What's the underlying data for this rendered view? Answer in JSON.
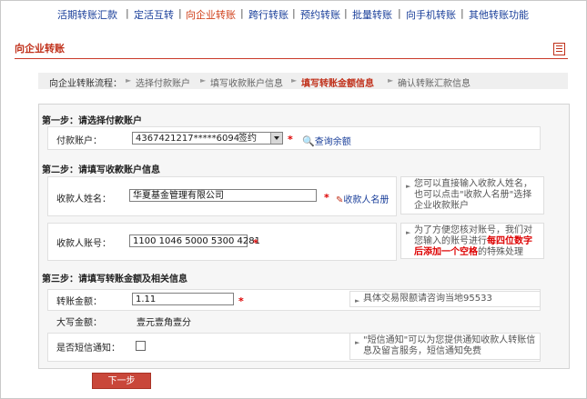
{
  "nav": {
    "items": [
      {
        "label": "活期转账汇款",
        "active": false
      },
      {
        "label": "定活互转",
        "active": false
      },
      {
        "label": "向企业转账",
        "active": true
      },
      {
        "label": "跨行转账",
        "active": false
      },
      {
        "label": "预约转账",
        "active": false
      },
      {
        "label": "批量转账",
        "active": false
      },
      {
        "label": "向手机转账",
        "active": false
      },
      {
        "label": "其他转账功能",
        "active": false
      }
    ],
    "separator": "|"
  },
  "page_title": "向企业转账",
  "breadcrumb": {
    "lead": "向企业转账流程：",
    "steps": [
      "选择付款账户",
      "填写收款账户信息",
      "填写转账金额信息",
      "确认转账汇款信息"
    ],
    "current_index": 2
  },
  "step1": {
    "title": "第一步：请选择付款账户",
    "account_label": "付款账户：",
    "account_value": "4367421217*****6094",
    "account_tag": "签约",
    "query_balance_link": "查询余额"
  },
  "step2": {
    "title": "第二步：请填写收款账户信息",
    "name_label": "收款人姓名：",
    "name_value": "华夏基金管理有限公司",
    "payee_list_link": "收款人名册",
    "name_hint": "您可以直接输入收款人姓名，也可以点击\"收款人名册\"选择企业收款账户",
    "account_label": "收款人账号：",
    "account_value": "1100 1046 5000 5300 4281",
    "account_hint_prefix": "为了方便您核对账号，我们对您输入的账号进行",
    "account_hint_emph": "每四位数字后添加一个空格",
    "account_hint_suffix": "的特殊处理"
  },
  "step3": {
    "title": "第三步：请填写转账金额及相关信息",
    "amount_label": "转账金额：",
    "amount_value": "1.11",
    "amount_hint": "具体交易限额请咨询当地95533",
    "capital_label": "大写金额：",
    "capital_value": "壹元壹角壹分",
    "sms_label": "是否短信通知：",
    "sms_checked": false,
    "sms_hint": "\"短信通知\"可以为您提供通知收款人转账信息及留言服务，短信通知免费"
  },
  "required_mark": "*",
  "next_button": "下一步",
  "colors": {
    "nav_link": "#1a3f9a",
    "accent": "#c0301a",
    "button": "#c9473a"
  }
}
